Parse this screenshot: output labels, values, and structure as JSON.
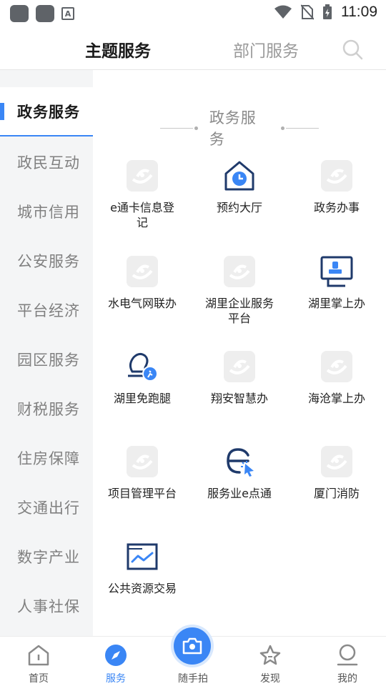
{
  "status_bar": {
    "time": "11:09"
  },
  "header": {
    "tabs": [
      {
        "label": "主题服务",
        "active": true
      },
      {
        "label": "部门服务",
        "active": false
      }
    ]
  },
  "sidebar": {
    "items": [
      {
        "label": "政务服务",
        "active": true
      },
      {
        "label": "政民互动"
      },
      {
        "label": "城市信用"
      },
      {
        "label": "公安服务"
      },
      {
        "label": "平台经济"
      },
      {
        "label": "园区服务"
      },
      {
        "label": "财税服务"
      },
      {
        "label": "住房保障"
      },
      {
        "label": "交通出行"
      },
      {
        "label": "数字产业"
      },
      {
        "label": "人事社保"
      }
    ]
  },
  "section": {
    "title": "政务服务"
  },
  "services": [
    {
      "label": "e通卡信息登记",
      "icon": "placeholder-logo-icon"
    },
    {
      "label": "预约大厅",
      "icon": "clock-house-icon"
    },
    {
      "label": "政务办事",
      "icon": "placeholder-logo-icon"
    },
    {
      "label": "水电气网联办",
      "icon": "placeholder-logo-icon"
    },
    {
      "label": "湖里企业服务平台",
      "icon": "placeholder-logo-icon"
    },
    {
      "label": "湖里掌上办",
      "icon": "stamp-screen-icon"
    },
    {
      "label": "湖里免跑腿",
      "icon": "runner-stamp-icon"
    },
    {
      "label": "翔安智慧办",
      "icon": "placeholder-logo-icon"
    },
    {
      "label": "海沧掌上办",
      "icon": "placeholder-logo-icon"
    },
    {
      "label": "项目管理平台",
      "icon": "placeholder-logo-icon"
    },
    {
      "label": "服务业e点通",
      "icon": "e-click-icon"
    },
    {
      "label": "厦门消防",
      "icon": "placeholder-logo-icon"
    },
    {
      "label": "公共资源交易",
      "icon": "chart-folder-icon"
    }
  ],
  "bottom_nav": {
    "items": [
      {
        "label": "首页",
        "icon": "home-icon"
      },
      {
        "label": "服务",
        "icon": "compass-icon",
        "active": true
      },
      {
        "label": "随手拍",
        "icon": "camera-icon"
      },
      {
        "label": "发现",
        "icon": "star-icon"
      },
      {
        "label": "我的",
        "icon": "person-icon"
      }
    ]
  },
  "colors": {
    "accent": "#3a86f5",
    "icon_navy": "#1f3a6b",
    "muted_text": "#808080"
  }
}
